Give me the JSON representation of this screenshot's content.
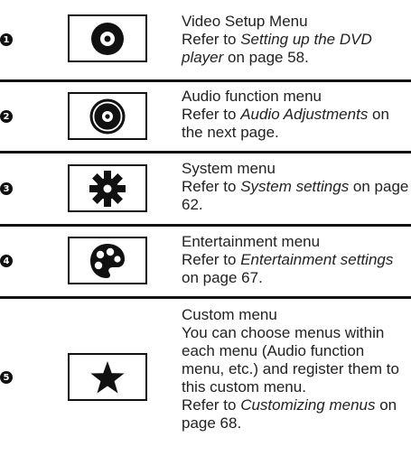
{
  "rows": [
    {
      "num": "1",
      "icon": "disc-icon",
      "title": "Video Setup Menu",
      "ref_prefix": "Refer to ",
      "ref_italic": "Setting up the DVD player",
      "ref_suffix": " on page 58."
    },
    {
      "num": "2",
      "icon": "audio-disc-icon",
      "title": "Audio function menu",
      "ref_prefix": "Refer to ",
      "ref_italic": "Audio Adjustments",
      "ref_suffix": " on the next page."
    },
    {
      "num": "3",
      "icon": "gear-icon",
      "title": "System menu",
      "ref_prefix": "Refer to ",
      "ref_italic": "System settings",
      "ref_suffix": " on page 62."
    },
    {
      "num": "4",
      "icon": "palette-icon",
      "title": "Entertainment menu",
      "ref_prefix": "Refer to ",
      "ref_italic": "Entertainment settings",
      "ref_suffix": " on page 67."
    },
    {
      "num": "5",
      "icon": "star-icon",
      "title": "Custom menu",
      "body": "You can choose menus within each menu (Audio function menu, etc.) and register them to this custom menu.",
      "ref_prefix": "Refer to ",
      "ref_italic": "Customizing menus",
      "ref_suffix": " on page 68."
    }
  ]
}
